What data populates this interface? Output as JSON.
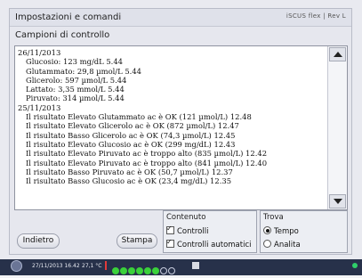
{
  "window": {
    "title": "Impostazioni e comandi",
    "brand": "iSCUS flex | Rev L"
  },
  "section_title": "Campioni di controllo",
  "list": {
    "lines": [
      {
        "text": "26/11/2013",
        "indent": false
      },
      {
        "text": "Glucosio: 123 mg/dL 5.44",
        "indent": true
      },
      {
        "text": "Glutammato: 29,8 µmol/L 5.44",
        "indent": true
      },
      {
        "text": "Glicerolo: 597 µmol/L 5.44",
        "indent": true
      },
      {
        "text": "Lattato: 3,35 mmol/L 5.44",
        "indent": true
      },
      {
        "text": "Piruvato: 314 µmol/L 5.44",
        "indent": true
      },
      {
        "text": "25/11/2013",
        "indent": false
      },
      {
        "text": "Il risultato Elevato Glutammato ac è OK (121 µmol/L) 12.48",
        "indent": true
      },
      {
        "text": "Il risultato Elevato Glicerolo ac è OK (872 µmol/L) 12.47",
        "indent": true
      },
      {
        "text": "Il risultato Basso Glicerolo ac è OK (74,3 µmol/L) 12.45",
        "indent": true
      },
      {
        "text": "Il risultato Elevato Glucosio ac è OK (299 mg/dL) 12.43",
        "indent": true
      },
      {
        "text": "Il risultato Elevato Piruvato ac è troppo alto (835 µmol/L) 12.42",
        "indent": true
      },
      {
        "text": "Il risultato Elevato Piruvato ac è troppo alto (841 µmol/L) 12.40",
        "indent": true
      },
      {
        "text": "Il risultato Basso Piruvato ac è OK (50,7 µmol/L) 12.37",
        "indent": true
      },
      {
        "text": "Il risultato Basso Glucosio ac è OK (23,4 mg/dL) 12.35",
        "indent": true
      }
    ]
  },
  "buttons": {
    "back": "Indietro",
    "print": "Stampa"
  },
  "content_group": {
    "title": "Contenuto",
    "opt1": "Controlli",
    "opt2": "Controlli automatici"
  },
  "find_group": {
    "title": "Trova",
    "opt1": "Tempo",
    "opt2": "Analita"
  },
  "status": {
    "datetime": "27/11/2013 16.42",
    "temp": "27,1 °C"
  },
  "colors": {
    "status_bar": "#27314a",
    "indicator_on": "#3ad13a"
  }
}
